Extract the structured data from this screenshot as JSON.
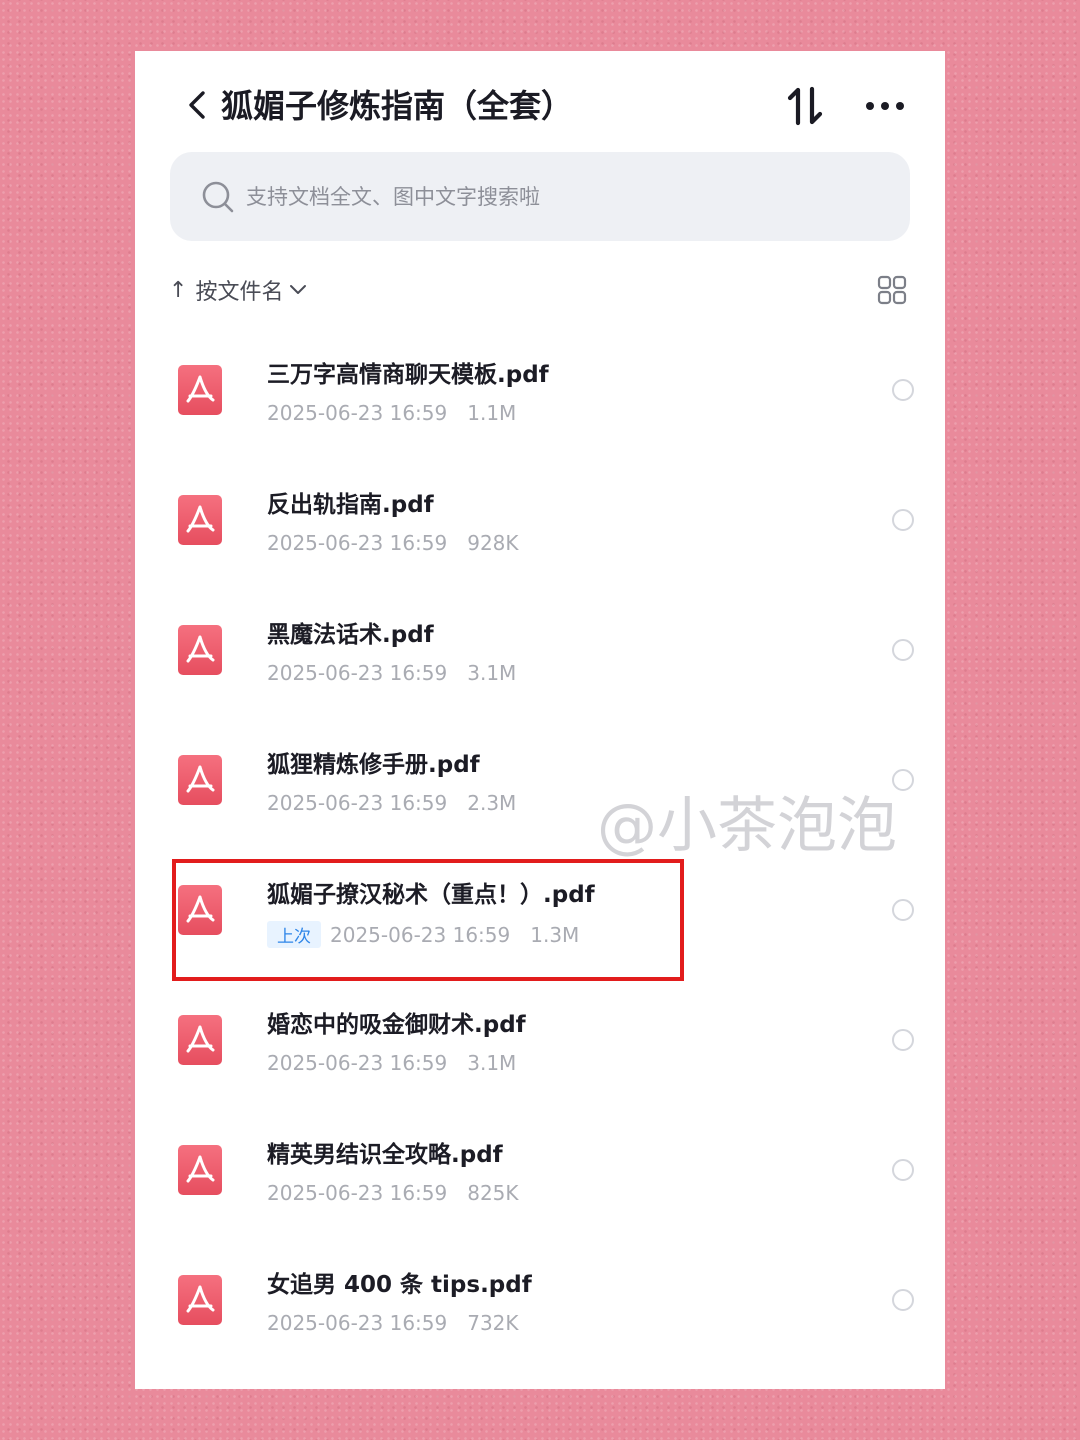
{
  "header": {
    "title": "狐媚子修炼指南（全套）"
  },
  "search": {
    "placeholder": "支持文档全文、图中文字搜索啦"
  },
  "sort": {
    "arrow": "↑",
    "label": "按文件名"
  },
  "files": [
    {
      "name": "三万字高情商聊天模板.pdf",
      "date": "2025-06-23 16:59",
      "size": "1.1M"
    },
    {
      "name": "反出轨指南.pdf",
      "date": "2025-06-23 16:59",
      "size": "928K"
    },
    {
      "name": "黑魔法话术.pdf",
      "date": "2025-06-23 16:59",
      "size": "3.1M"
    },
    {
      "name": "狐狸精炼修手册.pdf",
      "date": "2025-06-23 16:59",
      "size": "2.3M"
    },
    {
      "name": "狐媚子撩汉秘术（重点！）.pdf",
      "badge": "上次",
      "date": "2025-06-23 16:59",
      "size": "1.3M"
    },
    {
      "name": "婚恋中的吸金御财术.pdf",
      "date": "2025-06-23 16:59",
      "size": "3.1M"
    },
    {
      "name": "精英男结识全攻略.pdf",
      "date": "2025-06-23 16:59",
      "size": "825K"
    },
    {
      "name": "女追男 400 条 tips.pdf",
      "date": "2025-06-23 16:59",
      "size": "732K"
    }
  ],
  "watermark": "@小茶泡泡",
  "colors": {
    "background": "#e98a9b",
    "pdf_icon": "#ee5e6e",
    "highlight": "#e21c1c",
    "badge_text": "#2f86e8"
  },
  "icons": [
    "back-arrow-icon",
    "sort-toggle-icon",
    "more-icon",
    "search-icon",
    "chevron-down-icon",
    "grid-view-icon",
    "pdf-file-icon"
  ]
}
